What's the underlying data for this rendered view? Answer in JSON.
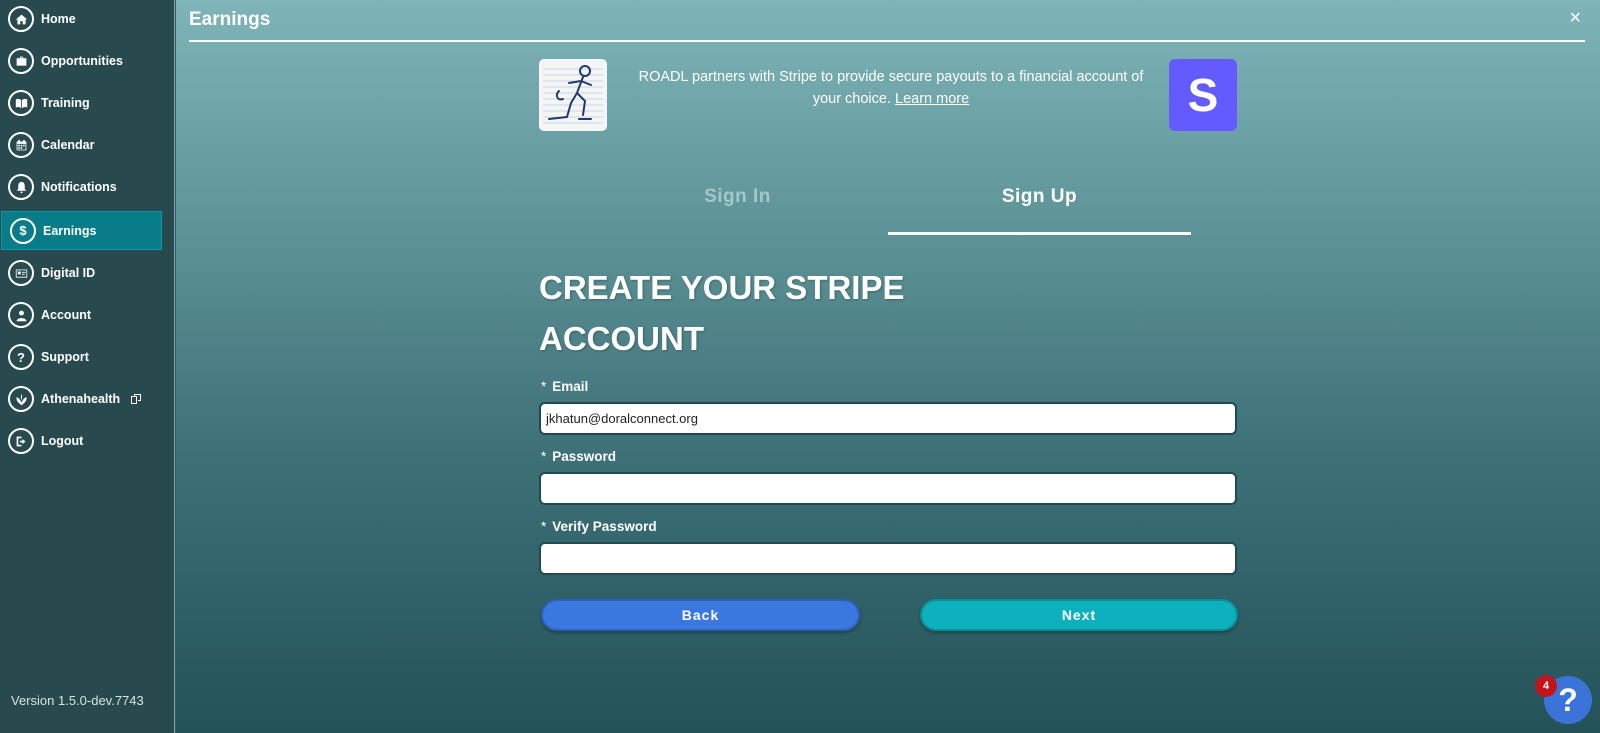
{
  "sidebar": {
    "items": [
      {
        "label": "Home",
        "icon": "home-icon"
      },
      {
        "label": "Opportunities",
        "icon": "briefcase-icon"
      },
      {
        "label": "Training",
        "icon": "book-icon"
      },
      {
        "label": "Calendar",
        "icon": "calendar-icon"
      },
      {
        "label": "Notifications",
        "icon": "bell-icon"
      },
      {
        "label": "Earnings",
        "icon": "dollar-icon",
        "active": true
      },
      {
        "label": "Digital ID",
        "icon": "id-card-icon"
      },
      {
        "label": "Account",
        "icon": "user-icon"
      },
      {
        "label": "Support",
        "icon": "question-icon"
      },
      {
        "label": "Athenahealth",
        "icon": "athenahealth-icon",
        "external": true
      },
      {
        "label": "Logout",
        "icon": "logout-icon"
      }
    ],
    "version": "Version 1.5.0-dev.7743"
  },
  "header": {
    "title": "Earnings",
    "close_label": "×"
  },
  "intro": {
    "text": "ROADL partners with Stripe to provide secure payouts to a financial account of your choice.",
    "link": "Learn more",
    "stripe_logo_letter": "S"
  },
  "tabs": {
    "sign_in": "Sign In",
    "sign_up": "Sign Up"
  },
  "form": {
    "title": "CREATE YOUR STRIPE ACCOUNT",
    "required_marker": "*",
    "email_label": "Email",
    "email_value": "jkhatun@doralconnect.org",
    "password_label": "Password",
    "password_value": "",
    "verify_label": "Verify Password",
    "verify_value": "",
    "back_label": "Back",
    "next_label": "Next"
  },
  "help": {
    "label": "?",
    "badge": "4"
  },
  "colors": {
    "sidebar_bg": "#284a4f",
    "active_item": "#087d89",
    "stripe_purple": "#635bff",
    "back_button": "#3a78e0",
    "next_button": "#0db1bd",
    "badge": "#c0151b"
  }
}
